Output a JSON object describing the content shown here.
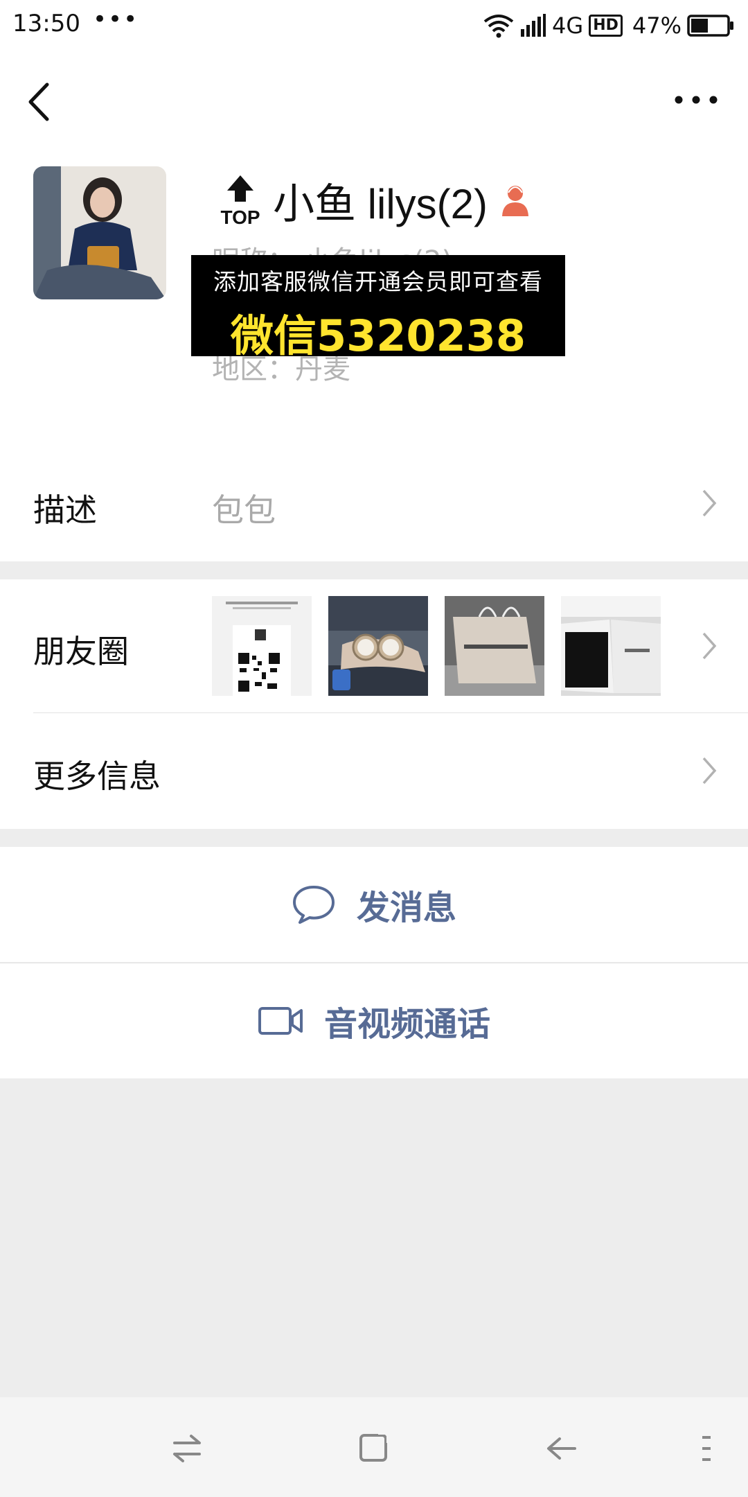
{
  "status_bar": {
    "time": "13:50",
    "dots": "•••",
    "network": "4G",
    "hd": "HD",
    "battery_percent": "47%",
    "battery_level": 0.47
  },
  "nav": {
    "back_icon": "chevron-left-icon",
    "more_icon": "more-dots-icon"
  },
  "profile": {
    "name": "小鱼 lilys(2)",
    "nickname_text": "昵称：  小鱼lilys(2)",
    "region_text": "地区：丹麦",
    "top_badge_text": "TOP",
    "overlay_line1": "添加客服微信开通会员即可查看",
    "overlay_line2": "微信5320238"
  },
  "rows": {
    "description_label": "描述",
    "description_value": "包包",
    "moments_label": "朋友圈",
    "more_info_label": "更多信息"
  },
  "actions": {
    "message_label": "发消息",
    "video_call_label": "音视频通话"
  },
  "colors": {
    "link_blue": "#576b95",
    "overlay_yellow": "#ffe42e",
    "gender_female": "#e86c52"
  }
}
